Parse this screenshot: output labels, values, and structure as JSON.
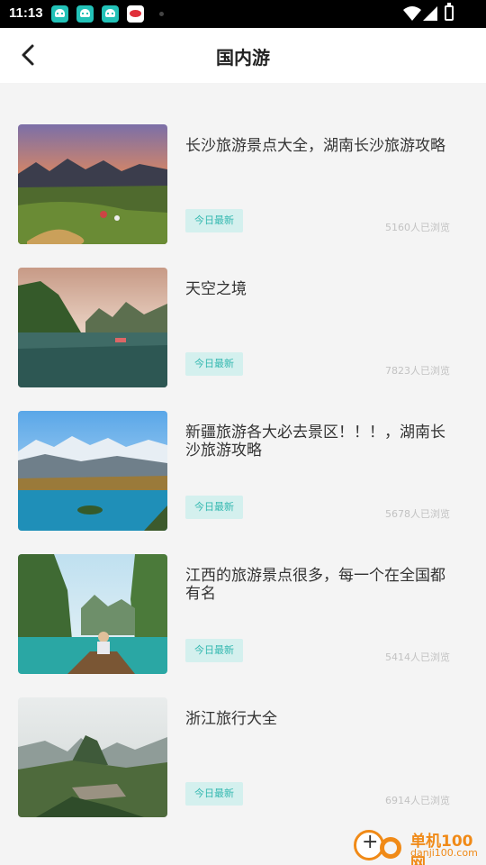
{
  "status_bar": {
    "time": "11:13",
    "icons": [
      "app-notification-icon",
      "app-notification-icon",
      "app-notification-icon",
      "red-app-icon",
      "wifi-icon",
      "signal-icon",
      "battery-icon"
    ]
  },
  "header": {
    "title": "国内游",
    "back_icon": "chevron-left-icon"
  },
  "articles": [
    {
      "title": "长沙旅游景点大全，湖南长沙旅游攻略",
      "badge": "今日最新",
      "views": "5160人已浏览"
    },
    {
      "title": "天空之境",
      "badge": "今日最新",
      "views": "7823人已浏览"
    },
    {
      "title": "新疆旅游各大必去景区！！！，湖南长沙旅游攻略",
      "badge": "今日最新",
      "views": "5678人已浏览"
    },
    {
      "title": "江西的旅游景点很多，每一个在全国都有名",
      "badge": "今日最新",
      "views": "5414人已浏览"
    },
    {
      "title": "浙江旅行大全",
      "badge": "今日最新",
      "views": "6914人已浏览"
    }
  ],
  "watermark": {
    "brand": "单机100网",
    "url": "danji100.com"
  },
  "colors": {
    "accent": "#33b8b0",
    "badge_bg": "#d4f0ee",
    "background": "#f4f4f4"
  }
}
